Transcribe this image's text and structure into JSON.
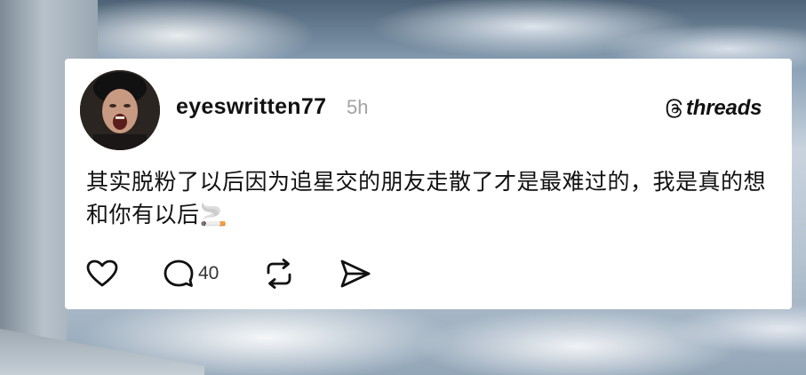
{
  "post": {
    "username": "eyeswritten77",
    "time": "5h",
    "brand": "threads",
    "text": "其实脱粉了以后因为追星交的朋友走散了才是最难过的，我是真的想和你有以后🚬",
    "reply_count": "40"
  },
  "icons": {
    "like": "heart-icon",
    "reply": "comment-icon",
    "repost": "repost-icon",
    "share": "send-icon",
    "logo": "threads-logo-icon"
  }
}
